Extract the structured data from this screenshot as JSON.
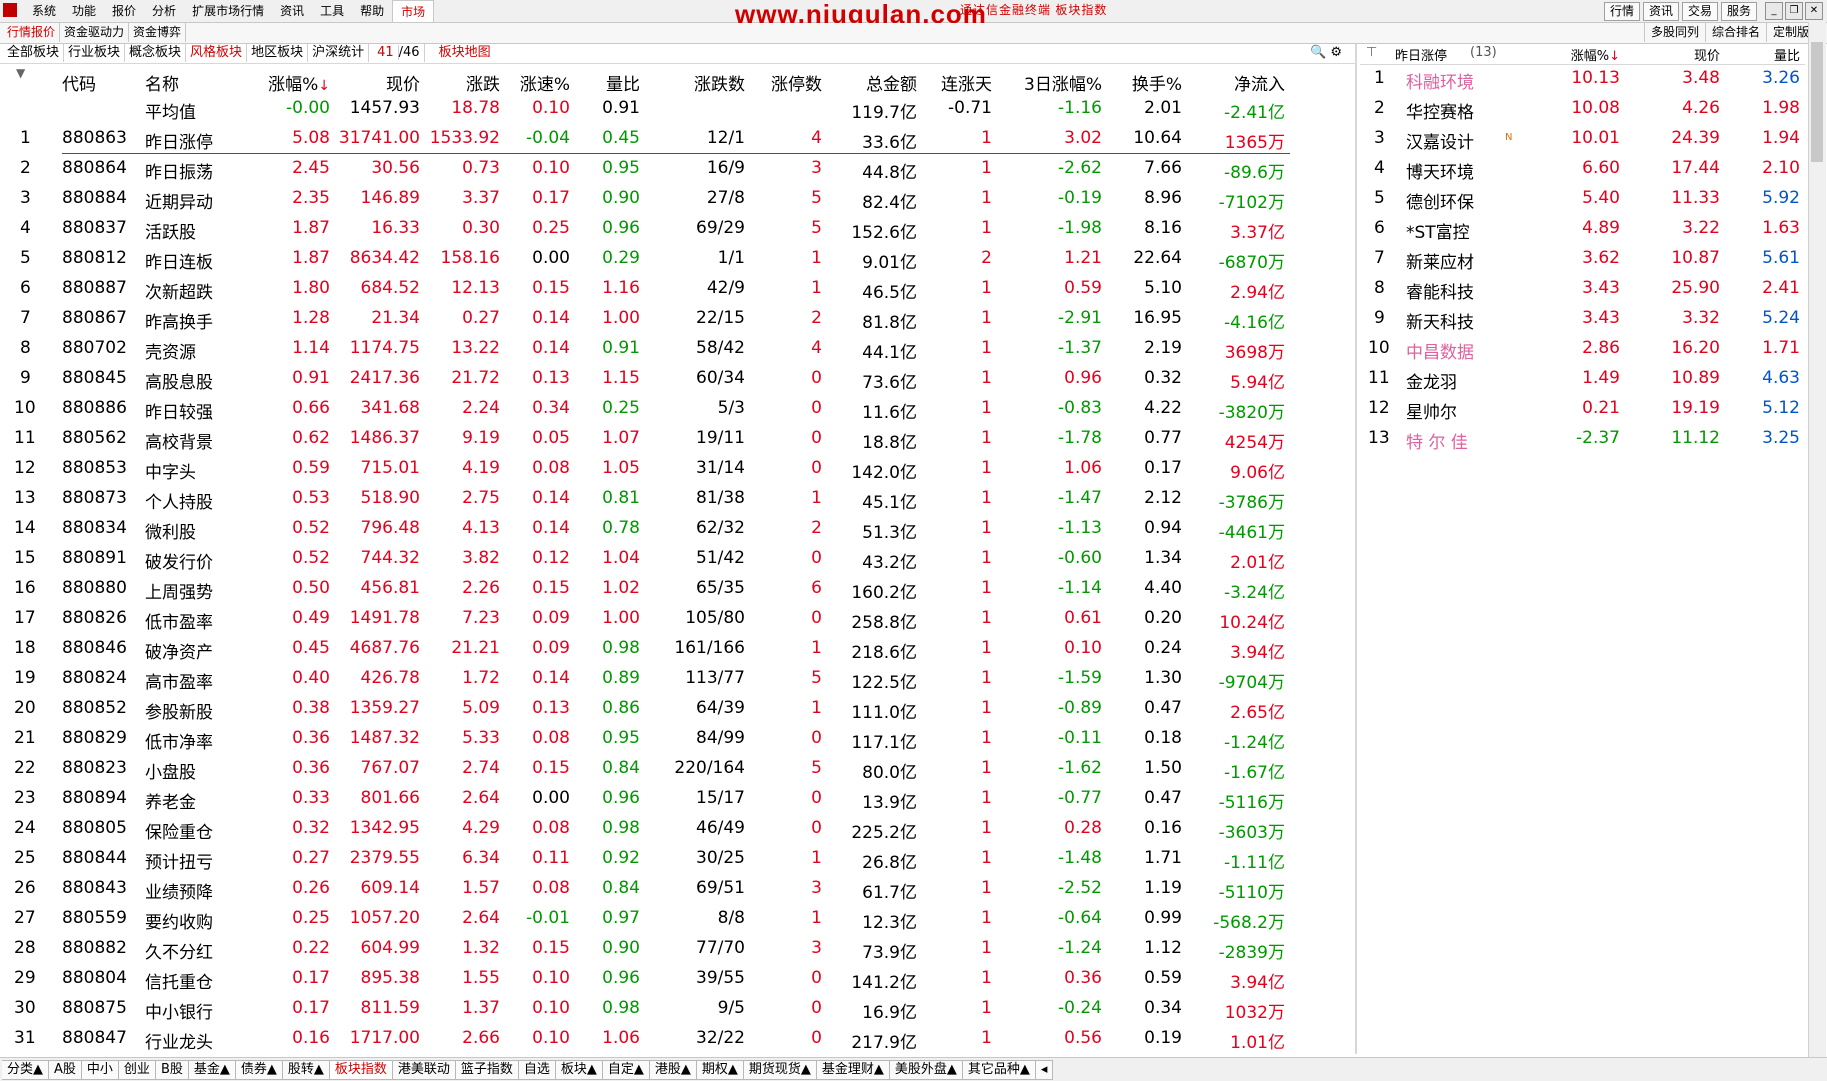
{
  "menu": {
    "items": [
      "系统",
      "功能",
      "报价",
      "分析",
      "扩展市场行情",
      "资讯",
      "工具",
      "帮助",
      "市场"
    ],
    "watermark": "www.niugulan.com",
    "window_title": "通达信金融终端 板块指数",
    "right_buttons": [
      "行情",
      "资讯",
      "交易",
      "服务"
    ]
  },
  "bar2": {
    "tabs": [
      "行情报价",
      "资金驱动力",
      "资金博弈"
    ],
    "right_tabs": [
      "多股同列",
      "综合排名",
      "定制版面"
    ]
  },
  "bar3": {
    "tabs": [
      "全部板块",
      "行业板块",
      "概念板块",
      "风格板块",
      "地区板块",
      "沪深统计"
    ],
    "count_a": "41",
    "count_b": "/46",
    "map": "板块地图"
  },
  "table": {
    "headers": [
      "代码",
      "名称",
      "涨幅%",
      "现价",
      "涨跌",
      "涨速%",
      "量比",
      "涨跌数",
      "涨停数",
      "总金额",
      "连涨天",
      "3日涨幅%",
      "换手%",
      "净流入"
    ],
    "avg": {
      "name": "平均值",
      "chg": "-0.00",
      "price": "1457.93",
      "diff": "18.78",
      "speed": "0.10",
      "vr": "0.91",
      "total": "119.7亿",
      "days": "-0.71",
      "d3": "-1.16",
      "turn": "2.01",
      "flow": "-2.41亿"
    },
    "rows": [
      [
        "1",
        "880863",
        "昨日涨停",
        "5.08",
        "31741.00",
        "1533.92",
        "-0.04",
        "0.45",
        "12/1",
        "4",
        "33.6亿",
        "1",
        "3.02",
        "10.64",
        "1365万"
      ],
      [
        "2",
        "880864",
        "昨日振荡",
        "2.45",
        "30.56",
        "0.73",
        "0.10",
        "0.95",
        "16/9",
        "3",
        "44.8亿",
        "1",
        "-2.62",
        "7.66",
        "-89.6万"
      ],
      [
        "3",
        "880884",
        "近期异动",
        "2.35",
        "146.89",
        "3.37",
        "0.17",
        "0.90",
        "27/8",
        "5",
        "82.4亿",
        "1",
        "-0.19",
        "8.96",
        "-7102万"
      ],
      [
        "4",
        "880837",
        "活跃股",
        "1.87",
        "16.33",
        "0.30",
        "0.25",
        "0.96",
        "69/29",
        "5",
        "152.6亿",
        "1",
        "-1.98",
        "8.16",
        "3.37亿"
      ],
      [
        "5",
        "880812",
        "昨日连板",
        "1.87",
        "8634.42",
        "158.16",
        "0.00",
        "0.29",
        "1/1",
        "1",
        "9.01亿",
        "2",
        "1.21",
        "22.64",
        "-6870万"
      ],
      [
        "6",
        "880887",
        "次新超跌",
        "1.80",
        "684.52",
        "12.13",
        "0.15",
        "1.16",
        "42/9",
        "1",
        "46.5亿",
        "1",
        "0.59",
        "5.10",
        "2.94亿"
      ],
      [
        "7",
        "880867",
        "昨高换手",
        "1.28",
        "21.34",
        "0.27",
        "0.14",
        "1.00",
        "22/15",
        "2",
        "81.8亿",
        "1",
        "-2.91",
        "16.95",
        "-4.16亿"
      ],
      [
        "8",
        "880702",
        "壳资源",
        "1.14",
        "1174.75",
        "13.22",
        "0.14",
        "0.91",
        "58/42",
        "4",
        "44.1亿",
        "1",
        "-1.37",
        "2.19",
        "3698万"
      ],
      [
        "9",
        "880845",
        "高股息股",
        "0.91",
        "2417.36",
        "21.72",
        "0.13",
        "1.15",
        "60/34",
        "0",
        "73.6亿",
        "1",
        "0.96",
        "0.32",
        "5.94亿"
      ],
      [
        "10",
        "880886",
        "昨日较强",
        "0.66",
        "341.68",
        "2.24",
        "0.34",
        "0.25",
        "5/3",
        "0",
        "11.6亿",
        "1",
        "-0.83",
        "4.22",
        "-3820万"
      ],
      [
        "11",
        "880562",
        "高校背景",
        "0.62",
        "1486.37",
        "9.19",
        "0.05",
        "1.07",
        "19/11",
        "0",
        "18.8亿",
        "1",
        "-1.78",
        "0.77",
        "4254万"
      ],
      [
        "12",
        "880853",
        "中字头",
        "0.59",
        "715.01",
        "4.19",
        "0.08",
        "1.05",
        "31/14",
        "0",
        "142.0亿",
        "1",
        "1.06",
        "0.17",
        "9.06亿"
      ],
      [
        "13",
        "880873",
        "个人持股",
        "0.53",
        "518.90",
        "2.75",
        "0.14",
        "0.81",
        "81/38",
        "1",
        "45.1亿",
        "1",
        "-1.47",
        "2.12",
        "-3786万"
      ],
      [
        "14",
        "880834",
        "微利股",
        "0.52",
        "796.48",
        "4.13",
        "0.14",
        "0.78",
        "62/32",
        "2",
        "51.3亿",
        "1",
        "-1.13",
        "0.94",
        "-4461万"
      ],
      [
        "15",
        "880891",
        "破发行价",
        "0.52",
        "744.32",
        "3.82",
        "0.12",
        "1.04",
        "51/42",
        "0",
        "43.2亿",
        "1",
        "-0.60",
        "1.34",
        "2.01亿"
      ],
      [
        "16",
        "880880",
        "上周强势",
        "0.50",
        "456.81",
        "2.26",
        "0.15",
        "1.02",
        "65/35",
        "6",
        "160.2亿",
        "1",
        "-1.14",
        "4.40",
        "-3.24亿"
      ],
      [
        "17",
        "880826",
        "低市盈率",
        "0.49",
        "1491.78",
        "7.23",
        "0.09",
        "1.00",
        "105/80",
        "0",
        "258.8亿",
        "1",
        "0.61",
        "0.20",
        "10.24亿"
      ],
      [
        "18",
        "880846",
        "破净资产",
        "0.45",
        "4687.76",
        "21.21",
        "0.09",
        "0.98",
        "161/166",
        "1",
        "218.6亿",
        "1",
        "0.10",
        "0.24",
        "3.94亿"
      ],
      [
        "19",
        "880824",
        "高市盈率",
        "0.40",
        "426.78",
        "1.72",
        "0.14",
        "0.89",
        "113/77",
        "5",
        "122.5亿",
        "1",
        "-1.59",
        "1.30",
        "-9704万"
      ],
      [
        "20",
        "880852",
        "参股新股",
        "0.38",
        "1359.27",
        "5.09",
        "0.13",
        "0.86",
        "64/39",
        "1",
        "111.0亿",
        "1",
        "-0.89",
        "0.47",
        "2.65亿"
      ],
      [
        "21",
        "880829",
        "低市净率",
        "0.36",
        "1487.32",
        "5.33",
        "0.08",
        "0.95",
        "84/99",
        "0",
        "117.1亿",
        "1",
        "-0.11",
        "0.18",
        "-1.24亿"
      ],
      [
        "22",
        "880823",
        "小盘股",
        "0.36",
        "767.07",
        "2.74",
        "0.15",
        "0.84",
        "220/164",
        "5",
        "80.0亿",
        "1",
        "-1.62",
        "1.50",
        "-1.67亿"
      ],
      [
        "23",
        "880894",
        "养老金",
        "0.33",
        "801.66",
        "2.64",
        "0.00",
        "0.96",
        "15/17",
        "0",
        "13.9亿",
        "1",
        "-0.77",
        "0.47",
        "-5116万"
      ],
      [
        "24",
        "880805",
        "保险重仓",
        "0.32",
        "1342.95",
        "4.29",
        "0.08",
        "0.98",
        "46/49",
        "0",
        "225.2亿",
        "1",
        "0.28",
        "0.16",
        "-3603万"
      ],
      [
        "25",
        "880844",
        "预计扭亏",
        "0.27",
        "2379.55",
        "6.34",
        "0.11",
        "0.92",
        "30/25",
        "1",
        "26.8亿",
        "1",
        "-1.48",
        "1.71",
        "-1.11亿"
      ],
      [
        "26",
        "880843",
        "业绩预降",
        "0.26",
        "609.14",
        "1.57",
        "0.08",
        "0.84",
        "69/51",
        "3",
        "61.7亿",
        "1",
        "-2.52",
        "1.19",
        "-5110万"
      ],
      [
        "27",
        "880559",
        "要约收购",
        "0.25",
        "1057.20",
        "2.64",
        "-0.01",
        "0.97",
        "8/8",
        "1",
        "12.3亿",
        "1",
        "-0.64",
        "0.99",
        "-568.2万"
      ],
      [
        "28",
        "880882",
        "久不分红",
        "0.22",
        "604.99",
        "1.32",
        "0.15",
        "0.90",
        "77/70",
        "3",
        "73.9亿",
        "1",
        "-1.24",
        "1.12",
        "-2839万"
      ],
      [
        "29",
        "880804",
        "信托重仓",
        "0.17",
        "895.38",
        "1.55",
        "0.10",
        "0.96",
        "39/55",
        "0",
        "141.2亿",
        "1",
        "0.36",
        "0.59",
        "3.94亿"
      ],
      [
        "30",
        "880875",
        "中小银行",
        "0.17",
        "811.59",
        "1.37",
        "0.10",
        "0.98",
        "9/5",
        "0",
        "16.9亿",
        "1",
        "-0.24",
        "0.34",
        "1032万"
      ],
      [
        "31",
        "880847",
        "行业龙头",
        "0.16",
        "1717.00",
        "2.66",
        "0.10",
        "1.06",
        "32/22",
        "0",
        "217.9亿",
        "1",
        "0.56",
        "0.19",
        "1.01亿"
      ]
    ]
  },
  "side": {
    "title": "昨日涨停",
    "title_count": "(13)",
    "headers": [
      "涨幅%",
      "现价",
      "量比"
    ],
    "rows": [
      [
        "1",
        "科融环境",
        "10.13",
        "3.48",
        "3.26"
      ],
      [
        "2",
        "华控赛格",
        "10.08",
        "4.26",
        "1.98"
      ],
      [
        "3",
        "汉嘉设计",
        "10.01",
        "24.39",
        "1.94"
      ],
      [
        "4",
        "博天环境",
        "6.60",
        "17.44",
        "2.10"
      ],
      [
        "5",
        "德创环保",
        "5.40",
        "11.33",
        "5.92"
      ],
      [
        "6",
        "*ST富控",
        "4.89",
        "3.22",
        "1.63"
      ],
      [
        "7",
        "新莱应材",
        "3.62",
        "10.87",
        "5.61"
      ],
      [
        "8",
        "睿能科技",
        "3.43",
        "25.90",
        "2.41"
      ],
      [
        "9",
        "新天科技",
        "3.43",
        "3.32",
        "5.24"
      ],
      [
        "10",
        "中昌数据",
        "2.86",
        "16.20",
        "1.71"
      ],
      [
        "11",
        "金龙羽",
        "1.49",
        "10.89",
        "4.63"
      ],
      [
        "12",
        "星帅尔",
        "0.21",
        "19.19",
        "5.12"
      ],
      [
        "13",
        "特 尔 佳",
        "-2.37",
        "11.12",
        "3.25"
      ]
    ],
    "n_badge": "N"
  },
  "bottom": {
    "tabs": [
      "分类▲",
      "A股",
      "中小",
      "创业",
      "B股",
      "基金▲",
      "债券▲",
      "股转▲",
      "板块指数",
      "港美联动",
      "篮子指数",
      "自选",
      "板块▲",
      "自定▲",
      "港股▲",
      "期权▲",
      "期货现货▲",
      "基金理财▲",
      "美股外盘▲",
      "其它品种▲"
    ]
  }
}
